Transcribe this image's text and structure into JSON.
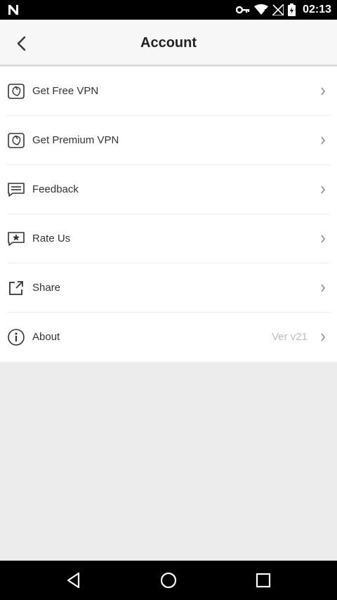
{
  "status_bar": {
    "time": "02:13"
  },
  "header": {
    "title": "Account"
  },
  "menu": {
    "items": [
      {
        "label": "Get Free VPN",
        "icon": "vpn-badge-icon",
        "value": ""
      },
      {
        "label": "Get Premium VPN",
        "icon": "vpn-badge-icon",
        "value": ""
      },
      {
        "label": "Feedback",
        "icon": "chat-message-icon",
        "value": ""
      },
      {
        "label": "Rate Us",
        "icon": "star-message-icon",
        "value": ""
      },
      {
        "label": "Share",
        "icon": "share-external-icon",
        "value": ""
      },
      {
        "label": "About",
        "icon": "info-icon",
        "value": "Ver v21"
      }
    ]
  },
  "colors": {
    "status_bar": "#000000",
    "app_bar": "#f7f7f7",
    "list_background": "#ffffff",
    "page_background": "#ececec",
    "text": "#333333",
    "secondary_text": "#bdbdbd"
  }
}
